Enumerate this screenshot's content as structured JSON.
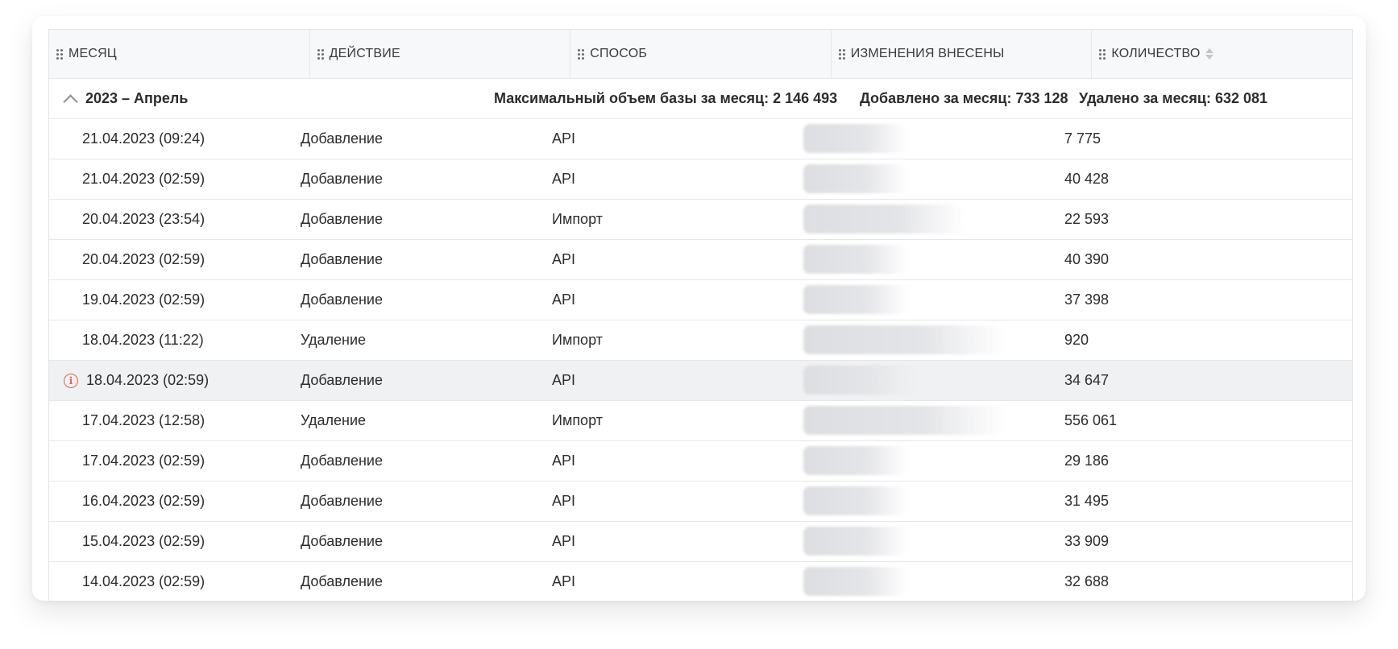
{
  "columns": [
    {
      "label": "МЕСЯЦ"
    },
    {
      "label": "ДЕЙСТВИЕ"
    },
    {
      "label": "СПОСОБ"
    },
    {
      "label": "ИЗМЕНЕНИЯ ВНЕСЕНЫ"
    },
    {
      "label": "КОЛИЧЕСТВО"
    }
  ],
  "group": {
    "title": "2023 – Апрель",
    "max_volume": "Максимальный объем базы за месяц: 2 146 493",
    "added": "Добавлено за месяц: 733 128",
    "deleted": "Удалено за месяц: 632 081"
  },
  "rows": [
    {
      "date": "21.04.2023 (09:24)",
      "action": "Добавление",
      "method": "API",
      "qty": "7 775"
    },
    {
      "date": "21.04.2023 (02:59)",
      "action": "Добавление",
      "method": "API",
      "qty": "40 428"
    },
    {
      "date": "20.04.2023 (23:54)",
      "action": "Добавление",
      "method": "Импорт",
      "qty": "22 593"
    },
    {
      "date": "20.04.2023 (02:59)",
      "action": "Добавление",
      "method": "API",
      "qty": "40 390"
    },
    {
      "date": "19.04.2023 (02:59)",
      "action": "Добавление",
      "method": "API",
      "qty": "37 398"
    },
    {
      "date": "18.04.2023 (11:22)",
      "action": "Удаление",
      "method": "Импорт",
      "qty": "920"
    },
    {
      "date": "18.04.2023 (02:59)",
      "action": "Добавление",
      "method": "API",
      "qty": "34 647"
    },
    {
      "date": "17.04.2023 (12:58)",
      "action": "Удаление",
      "method": "Импорт",
      "qty": "556 061"
    },
    {
      "date": "17.04.2023 (02:59)",
      "action": "Добавление",
      "method": "API",
      "qty": "29 186"
    },
    {
      "date": "16.04.2023 (02:59)",
      "action": "Добавление",
      "method": "API",
      "qty": "31 495"
    },
    {
      "date": "15.04.2023 (02:59)",
      "action": "Добавление",
      "method": "API",
      "qty": "33 909"
    },
    {
      "date": "14.04.2023 (02:59)",
      "action": "Добавление",
      "method": "API",
      "qty": "32 688"
    }
  ],
  "colors": {
    "header_bg": "#f7f8f9",
    "border": "#e6e7ea",
    "highlight_row": "#f0f1f3",
    "alert": "#e2644f"
  },
  "icons": {
    "drag_handle": "drag-handle-icon",
    "sort": "sort-icon",
    "collapse": "chevron-up-icon",
    "alert": "info-circle-icon"
  }
}
